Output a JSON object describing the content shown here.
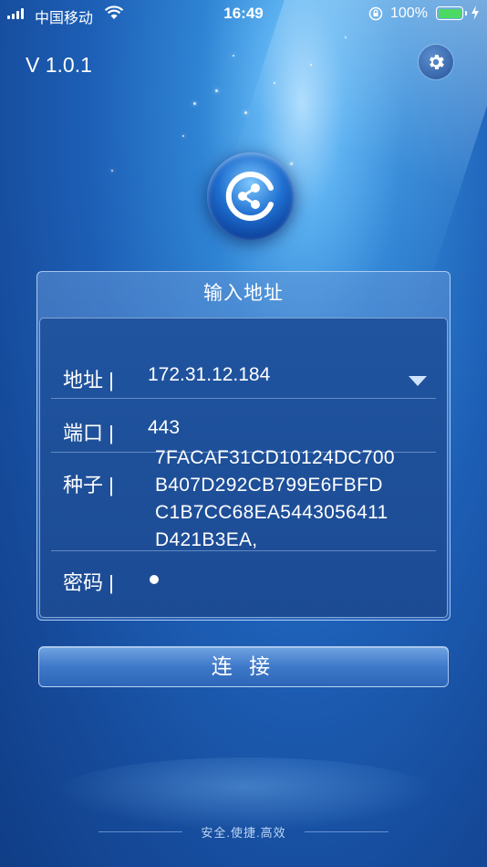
{
  "status_bar": {
    "carrier": "中国移动",
    "time": "16:49",
    "battery_percent": "100%",
    "battery_level": 1.0,
    "battery_color": "#4cd964"
  },
  "version": "V 1.0.1",
  "icons": {
    "settings": "gear-icon",
    "logo": "share-node-logo"
  },
  "panel": {
    "title": "输入地址",
    "fields": {
      "address": {
        "label": "地址 |",
        "value": "172.31.12.184"
      },
      "port": {
        "label": "端口 |",
        "value": "443"
      },
      "seed": {
        "label": "种子 |",
        "lines": [
          "7FACAF31CD10124DC700",
          "B407D292CB799E6FBFD",
          "C1B7CC68EA5443056411",
          "D421B3EA,"
        ]
      },
      "password": {
        "label": "密码 |",
        "value_dots": 1
      }
    }
  },
  "connect_button": "连 接",
  "tagline": "安全.使捷.高效"
}
